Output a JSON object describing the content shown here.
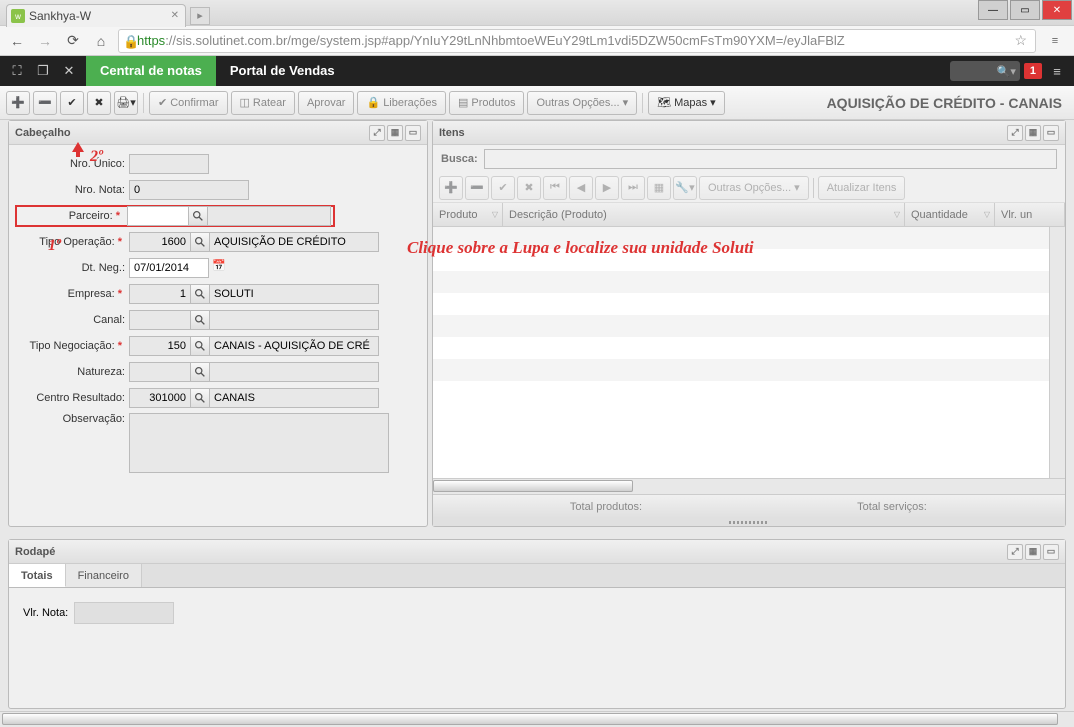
{
  "browser": {
    "tab_title": "Sankhya-W",
    "url_prefix": "https",
    "url_rest": "://sis.solutinet.com.br/mge/system.jsp#app/YnIuY29tLnNhbmtoeWEuY29tLm1vdi5DZW50cmFsTm90YXM=/eyJlaFBlZ"
  },
  "appbar": {
    "tab_active": "Central de notas",
    "tab_2": "Portal de Vendas",
    "badge": "1"
  },
  "toolbar": {
    "confirmar": "Confirmar",
    "ratear": "Ratear",
    "aprovar": "Aprovar",
    "liberacoes": "Liberações",
    "produtos": "Produtos",
    "outras": "Outras Opções...",
    "mapas": "Mapas",
    "page_title": "AQUISIÇÃO DE CRÉDITO - CANAIS"
  },
  "panels": {
    "cabecalho": "Cabeçalho",
    "itens": "Itens",
    "rodape": "Rodapé"
  },
  "form": {
    "nro_unico_lbl": "Nro. Único:",
    "nro_unico_val": "",
    "nro_nota_lbl": "Nro. Nota:",
    "nro_nota_val": "0",
    "parceiro_lbl": "Parceiro:",
    "parceiro_val": "",
    "tipo_oper_lbl": "Tipo Operação:",
    "tipo_oper_val": "1600",
    "tipo_oper_desc": "AQUISIÇÃO DE CRÉDITO",
    "dt_neg_lbl": "Dt. Neg.:",
    "dt_neg_val": "07/01/2014",
    "empresa_lbl": "Empresa:",
    "empresa_val": "1",
    "empresa_desc": "SOLUTI",
    "canal_lbl": "Canal:",
    "canal_val": "",
    "tipo_neg_lbl": "Tipo Negociação:",
    "tipo_neg_val": "150",
    "tipo_neg_desc": "CANAIS - AQUISIÇÃO DE CRÉ",
    "natureza_lbl": "Natureza:",
    "natureza_val": "",
    "centro_res_lbl": "Centro Resultado:",
    "centro_res_val": "301000",
    "centro_res_desc": "CANAIS",
    "observacao_lbl": "Observação:"
  },
  "itens": {
    "busca_lbl": "Busca:",
    "outras": "Outras Opções...",
    "atualizar": "Atualizar Itens",
    "col_produto": "Produto",
    "col_descricao": "Descrição (Produto)",
    "col_quantidade": "Quantidade",
    "col_vlr": "Vlr. un",
    "total_prod": "Total produtos:",
    "total_serv": "Total serviços:"
  },
  "rodape": {
    "tab_totais": "Totais",
    "tab_financeiro": "Financeiro",
    "vlr_nota_lbl": "Vlr. Nota:"
  },
  "annot": {
    "n1": "1º",
    "n2": "2º",
    "hint": "Clique sobre a Lupa e localize sua unidade Soluti"
  }
}
